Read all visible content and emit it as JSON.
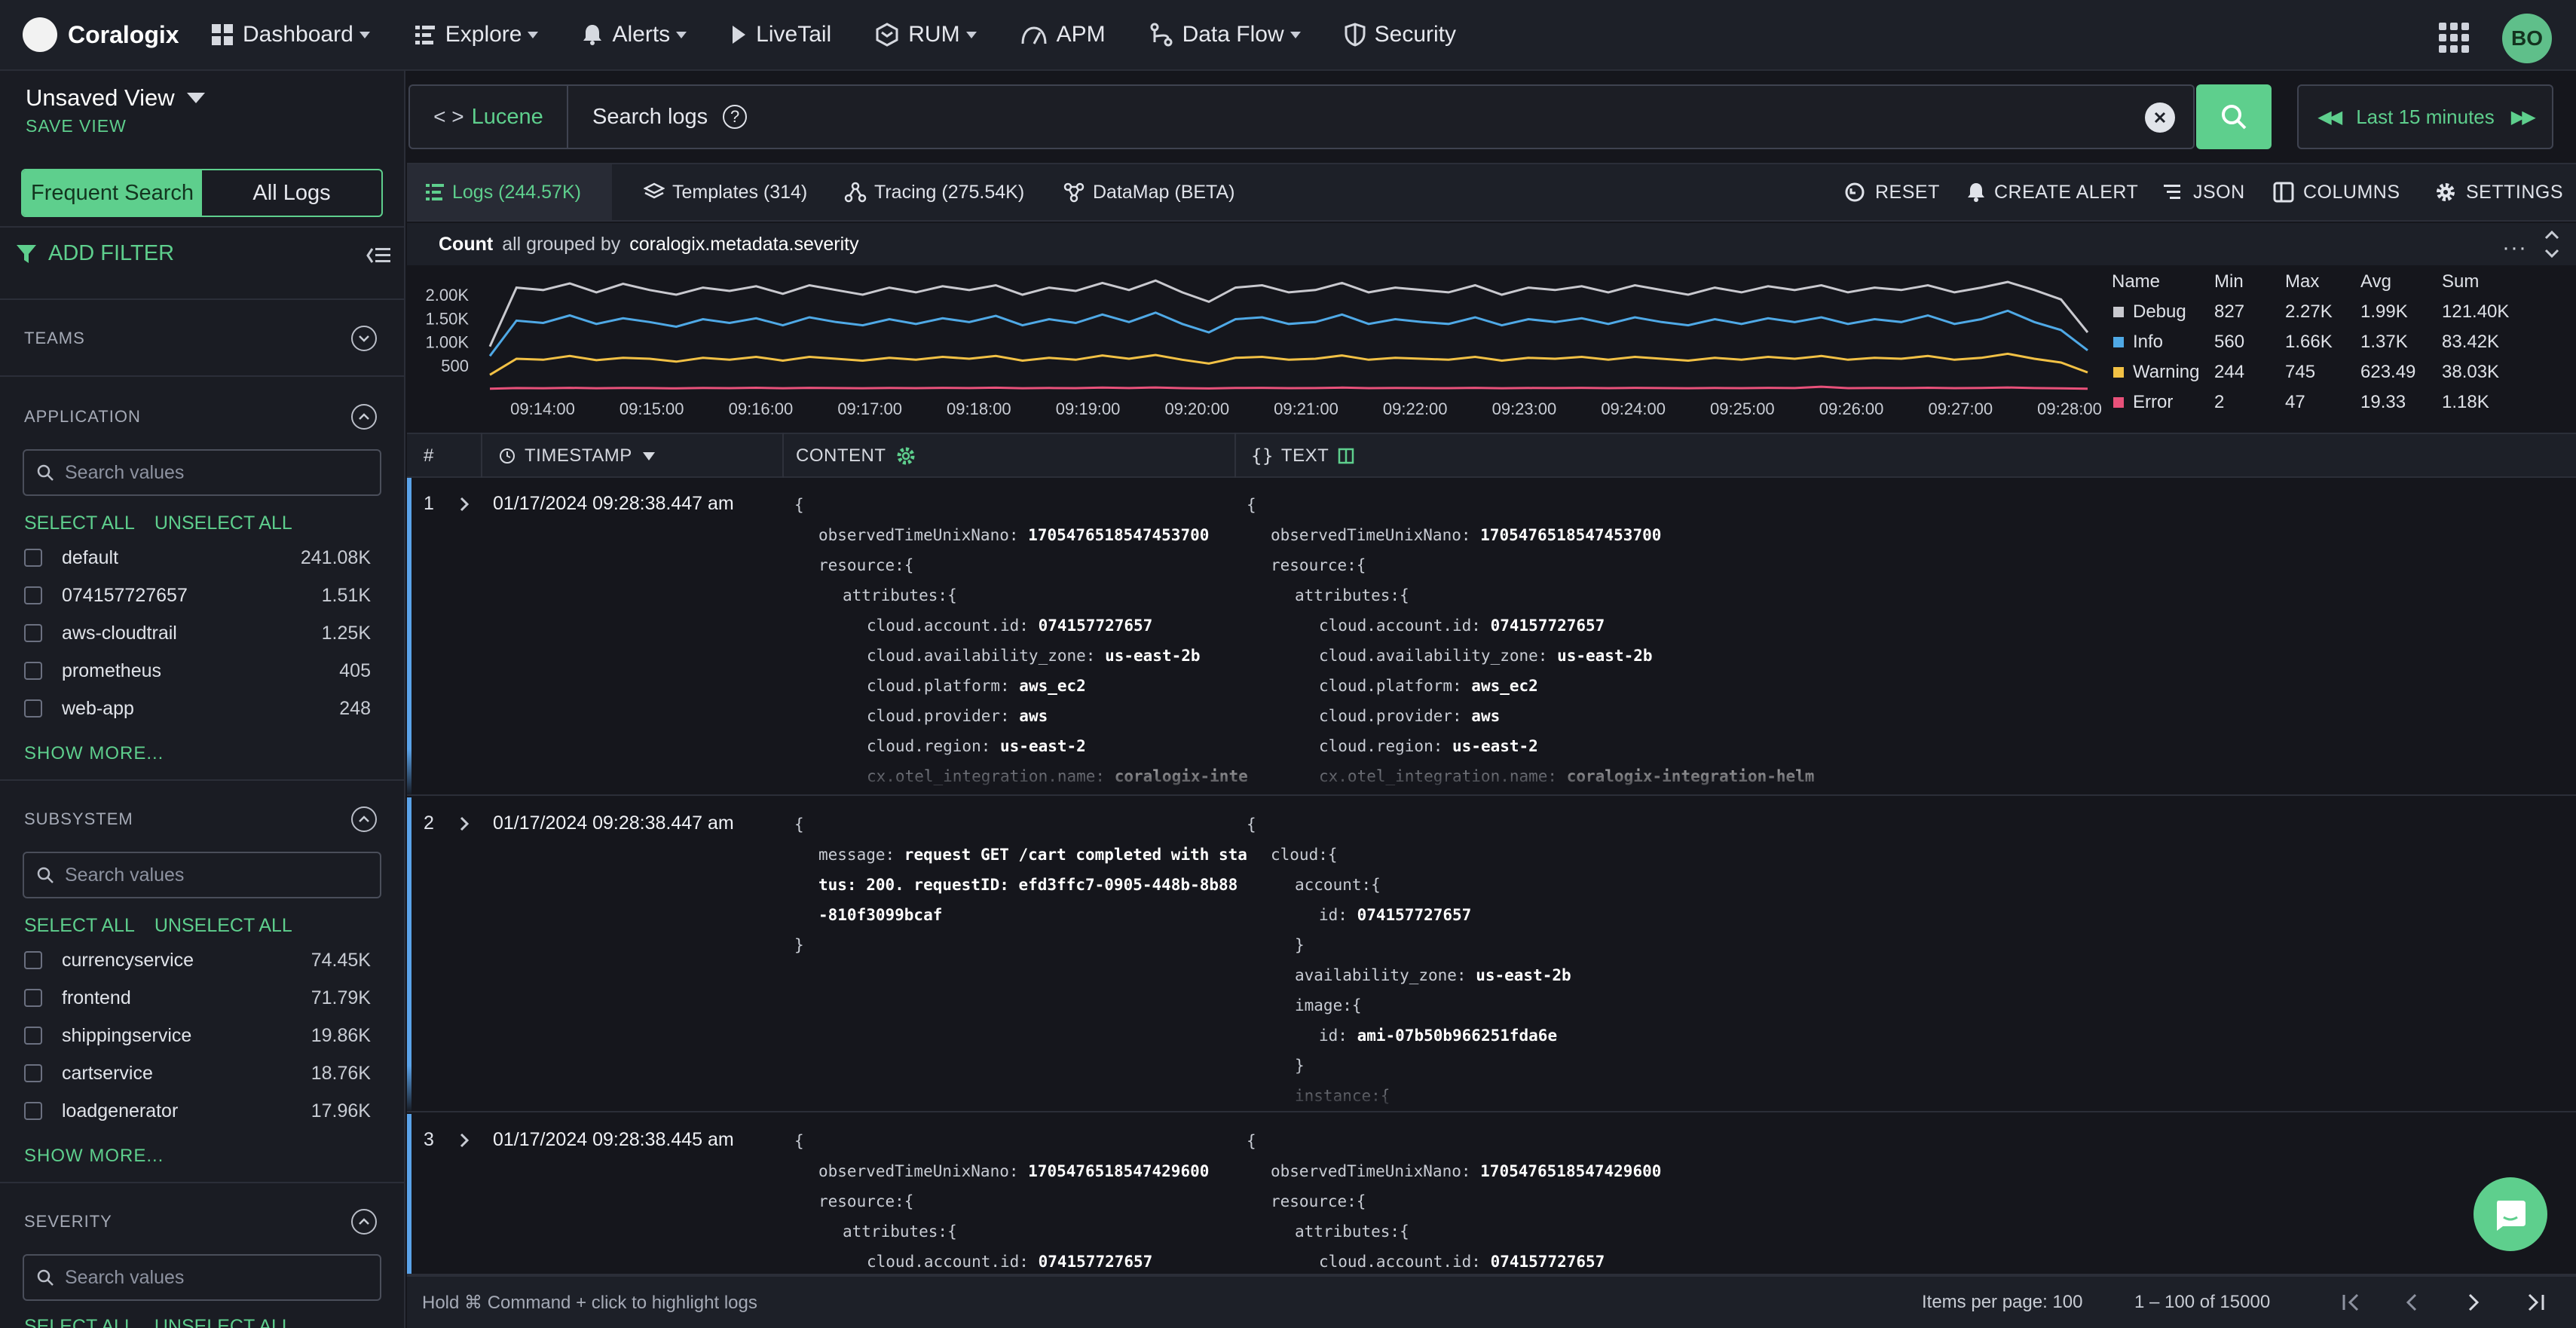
{
  "brand": {
    "name": "Coralogix"
  },
  "nav": {
    "dashboard": "Dashboard",
    "explore": "Explore",
    "alerts": "Alerts",
    "livetail": "LiveTail",
    "rum": "RUM",
    "apm": "APM",
    "dataflow": "Data Flow",
    "security": "Security",
    "avatar": "BO"
  },
  "view": {
    "name": "Unsaved View",
    "save": "SAVE VIEW"
  },
  "sidebar": {
    "tab_frequent": "Frequent Search",
    "tab_all": "All Logs",
    "add_filter": "ADD FILTER",
    "teams": "TEAMS",
    "application": {
      "title": "APPLICATION",
      "placeholder": "Search values",
      "select_all": "SELECT ALL",
      "unselect_all": "UNSELECT ALL",
      "items": [
        {
          "name": "default",
          "count": "241.08K"
        },
        {
          "name": "074157727657",
          "count": "1.51K"
        },
        {
          "name": "aws-cloudtrail",
          "count": "1.25K"
        },
        {
          "name": "prometheus",
          "count": "405"
        },
        {
          "name": "web-app",
          "count": "248"
        }
      ],
      "show_more": "SHOW MORE..."
    },
    "subsystem": {
      "title": "SUBSYSTEM",
      "placeholder": "Search values",
      "select_all": "SELECT ALL",
      "unselect_all": "UNSELECT ALL",
      "items": [
        {
          "name": "currencyservice",
          "count": "74.45K"
        },
        {
          "name": "frontend",
          "count": "71.79K"
        },
        {
          "name": "shippingservice",
          "count": "19.86K"
        },
        {
          "name": "cartservice",
          "count": "18.76K"
        },
        {
          "name": "loadgenerator",
          "count": "17.96K"
        }
      ],
      "show_more": "SHOW MORE..."
    },
    "severity": {
      "title": "SEVERITY",
      "placeholder": "Search values",
      "select_all": "SELECT ALL",
      "unselect_all": "UNSELECT ALL"
    }
  },
  "search": {
    "mode": "Lucene",
    "placeholder": "Search logs",
    "time_range": "Last 15 minutes"
  },
  "tabs": [
    {
      "label": "Logs (244.57K)"
    },
    {
      "label": "Templates (314)"
    },
    {
      "label": "Tracing (275.54K)"
    },
    {
      "label": "DataMap (BETA)"
    }
  ],
  "actions": {
    "reset": "RESET",
    "create_alert": "CREATE ALERT",
    "json": "JSON",
    "columns": "COLUMNS",
    "settings": "SETTINGS"
  },
  "graph_header": {
    "count": "Count",
    "middle": "all grouped by",
    "field": "coralogix.metadata.severity"
  },
  "legend": {
    "headers": [
      "Name",
      "Min",
      "Max",
      "Avg",
      "Sum"
    ],
    "rows": [
      {
        "name": "Debug",
        "color": "#c9c9cf",
        "min": "827",
        "max": "2.27K",
        "avg": "1.99K",
        "sum": "121.40K"
      },
      {
        "name": "Info",
        "color": "#4fa9e6",
        "min": "560",
        "max": "1.66K",
        "avg": "1.37K",
        "sum": "83.42K"
      },
      {
        "name": "Warning",
        "color": "#f2c145",
        "min": "244",
        "max": "745",
        "avg": "623.49",
        "sum": "38.03K"
      },
      {
        "name": "Error",
        "color": "#e8517a",
        "min": "2",
        "max": "47",
        "avg": "19.33",
        "sum": "1.18K"
      }
    ]
  },
  "chart_data": {
    "type": "line",
    "y_ticks": [
      "2.00K",
      "1.50K",
      "1.00K",
      "500"
    ],
    "ylim": [
      0,
      2400
    ],
    "x": [
      "09:14:00",
      "09:15:00",
      "09:16:00",
      "09:17:00",
      "09:18:00",
      "09:19:00",
      "09:20:00",
      "09:21:00",
      "09:22:00",
      "09:23:00",
      "09:24:00",
      "09:25:00",
      "09:26:00",
      "09:27:00",
      "09:28:00"
    ],
    "series": [
      {
        "name": "Debug",
        "color": "#c9c9cf",
        "values": [
          900,
          2150,
          2100,
          2240,
          2050,
          2230,
          2100,
          2000,
          2150,
          2080,
          2180,
          2020,
          2200,
          2100,
          2000,
          2150,
          2050,
          2180,
          2100,
          2200,
          2000,
          2150,
          2080,
          2250,
          2100,
          2300,
          2050,
          1850,
          2150,
          2200,
          2050,
          2100,
          2250,
          2050,
          2150,
          2100,
          2050,
          2200,
          2000,
          2150,
          2100,
          2180,
          2050,
          2200,
          2100,
          2000,
          2150,
          2050,
          2180,
          2100,
          2200,
          2050,
          2150,
          2100,
          2200,
          2050,
          2150,
          2270,
          2100,
          1900,
          1200
        ]
      },
      {
        "name": "Info",
        "color": "#4fa9e6",
        "values": [
          700,
          1450,
          1400,
          1560,
          1380,
          1500,
          1420,
          1320,
          1480,
          1400,
          1500,
          1350,
          1520,
          1420,
          1350,
          1480,
          1380,
          1500,
          1420,
          1550,
          1350,
          1480,
          1400,
          1580,
          1420,
          1620,
          1380,
          1200,
          1480,
          1520,
          1380,
          1420,
          1580,
          1380,
          1480,
          1420,
          1380,
          1520,
          1350,
          1480,
          1420,
          1500,
          1380,
          1520,
          1420,
          1350,
          1480,
          1380,
          1500,
          1420,
          1520,
          1380,
          1480,
          1420,
          1560,
          1380,
          1480,
          1660,
          1420,
          1250,
          820
        ]
      },
      {
        "name": "Warning",
        "color": "#f2c145",
        "values": [
          300,
          640,
          620,
          700,
          610,
          660,
          640,
          580,
          660,
          620,
          680,
          600,
          680,
          640,
          600,
          660,
          620,
          680,
          640,
          700,
          600,
          660,
          620,
          710,
          640,
          720,
          620,
          540,
          660,
          680,
          620,
          640,
          710,
          620,
          660,
          640,
          620,
          680,
          600,
          660,
          640,
          680,
          620,
          680,
          640,
          600,
          660,
          620,
          680,
          640,
          700,
          620,
          660,
          640,
          700,
          620,
          660,
          745,
          640,
          560,
          350
        ]
      },
      {
        "name": "Error",
        "color": "#e8517a",
        "values": [
          5,
          18,
          15,
          22,
          14,
          20,
          17,
          12,
          20,
          16,
          24,
          14,
          22,
          18,
          14,
          20,
          16,
          22,
          18,
          26,
          14,
          20,
          16,
          28,
          18,
          30,
          16,
          10,
          20,
          22,
          16,
          18,
          28,
          16,
          20,
          18,
          16,
          22,
          14,
          20,
          18,
          22,
          16,
          22,
          18,
          14,
          20,
          16,
          22,
          18,
          47,
          16,
          20,
          18,
          24,
          16,
          20,
          30,
          18,
          12,
          5
        ]
      }
    ]
  },
  "table": {
    "headers": {
      "num": "#",
      "timestamp": "TIMESTAMP",
      "content": "CONTENT",
      "text": "TEXT"
    },
    "rows": [
      {
        "num": "1",
        "timestamp": "01/17/2024 09:28:38.447 am",
        "content": [
          {
            "i": 0,
            "k": "{",
            "v": ""
          },
          {
            "i": 1,
            "k": "observedTimeUnixNano:",
            "v": "1705476518547453700"
          },
          {
            "i": 1,
            "k": "resource:{",
            "v": ""
          },
          {
            "i": 2,
            "k": "attributes:{",
            "v": ""
          },
          {
            "i": 3,
            "k": "cloud.account.id:",
            "v": "074157727657"
          },
          {
            "i": 3,
            "k": "cloud.availability_zone:",
            "v": "us-east-2b"
          },
          {
            "i": 3,
            "k": "cloud.platform:",
            "v": "aws_ec2"
          },
          {
            "i": 3,
            "k": "cloud.provider:",
            "v": "aws"
          },
          {
            "i": 3,
            "k": "cloud.region:",
            "v": "us-east-2"
          },
          {
            "i": 3,
            "k": "cx.otel_integration.name:",
            "v": "coralogix-inte"
          }
        ],
        "text": [
          {
            "i": 0,
            "k": "{",
            "v": ""
          },
          {
            "i": 1,
            "k": "observedTimeUnixNano:",
            "v": "1705476518547453700"
          },
          {
            "i": 1,
            "k": "resource:{",
            "v": ""
          },
          {
            "i": 2,
            "k": "attributes:{",
            "v": ""
          },
          {
            "i": 3,
            "k": "cloud.account.id:",
            "v": "074157727657"
          },
          {
            "i": 3,
            "k": "cloud.availability_zone:",
            "v": "us-east-2b"
          },
          {
            "i": 3,
            "k": "cloud.platform:",
            "v": "aws_ec2"
          },
          {
            "i": 3,
            "k": "cloud.provider:",
            "v": "aws"
          },
          {
            "i": 3,
            "k": "cloud.region:",
            "v": "us-east-2"
          },
          {
            "i": 3,
            "k": "cx.otel_integration.name:",
            "v": "coralogix-integration-helm"
          }
        ]
      },
      {
        "num": "2",
        "timestamp": "01/17/2024 09:28:38.447 am",
        "content": [
          {
            "i": 0,
            "k": "{",
            "v": ""
          },
          {
            "i": 1,
            "k": "message:",
            "v": "request GET /cart completed with sta"
          },
          {
            "i": 1,
            "k": "",
            "v": "tus: 200. requestID: efd3ffc7-0905-448b-8b88"
          },
          {
            "i": 1,
            "k": "",
            "v": "-810f3099bcaf"
          },
          {
            "i": 0,
            "k": "}",
            "v": ""
          }
        ],
        "text": [
          {
            "i": 0,
            "k": "{",
            "v": ""
          },
          {
            "i": 1,
            "k": "cloud:{",
            "v": ""
          },
          {
            "i": 2,
            "k": "account:{",
            "v": ""
          },
          {
            "i": 3,
            "k": "id:",
            "v": "074157727657"
          },
          {
            "i": 2,
            "k": "}",
            "v": ""
          },
          {
            "i": 2,
            "k": "availability_zone:",
            "v": "us-east-2b"
          },
          {
            "i": 2,
            "k": "image:{",
            "v": ""
          },
          {
            "i": 3,
            "k": "id:",
            "v": "ami-07b50b966251fda6e"
          },
          {
            "i": 2,
            "k": "}",
            "v": ""
          },
          {
            "i": 2,
            "k": "instance:{",
            "v": ""
          }
        ]
      },
      {
        "num": "3",
        "timestamp": "01/17/2024 09:28:38.445 am",
        "content": [
          {
            "i": 0,
            "k": "{",
            "v": ""
          },
          {
            "i": 1,
            "k": "observedTimeUnixNano:",
            "v": "1705476518547429600"
          },
          {
            "i": 1,
            "k": "resource:{",
            "v": ""
          },
          {
            "i": 2,
            "k": "attributes:{",
            "v": ""
          },
          {
            "i": 3,
            "k": "cloud.account.id:",
            "v": "074157727657"
          }
        ],
        "text": [
          {
            "i": 0,
            "k": "{",
            "v": ""
          },
          {
            "i": 1,
            "k": "observedTimeUnixNano:",
            "v": "1705476518547429600"
          },
          {
            "i": 1,
            "k": "resource:{",
            "v": ""
          },
          {
            "i": 2,
            "k": "attributes:{",
            "v": ""
          },
          {
            "i": 3,
            "k": "cloud.account.id:",
            "v": "074157727657"
          }
        ]
      }
    ]
  },
  "footer": {
    "hint": "Hold ⌘ Command + click to highlight logs",
    "items_per_page": "Items per page: 100",
    "range": "1 – 100 of 15000"
  }
}
